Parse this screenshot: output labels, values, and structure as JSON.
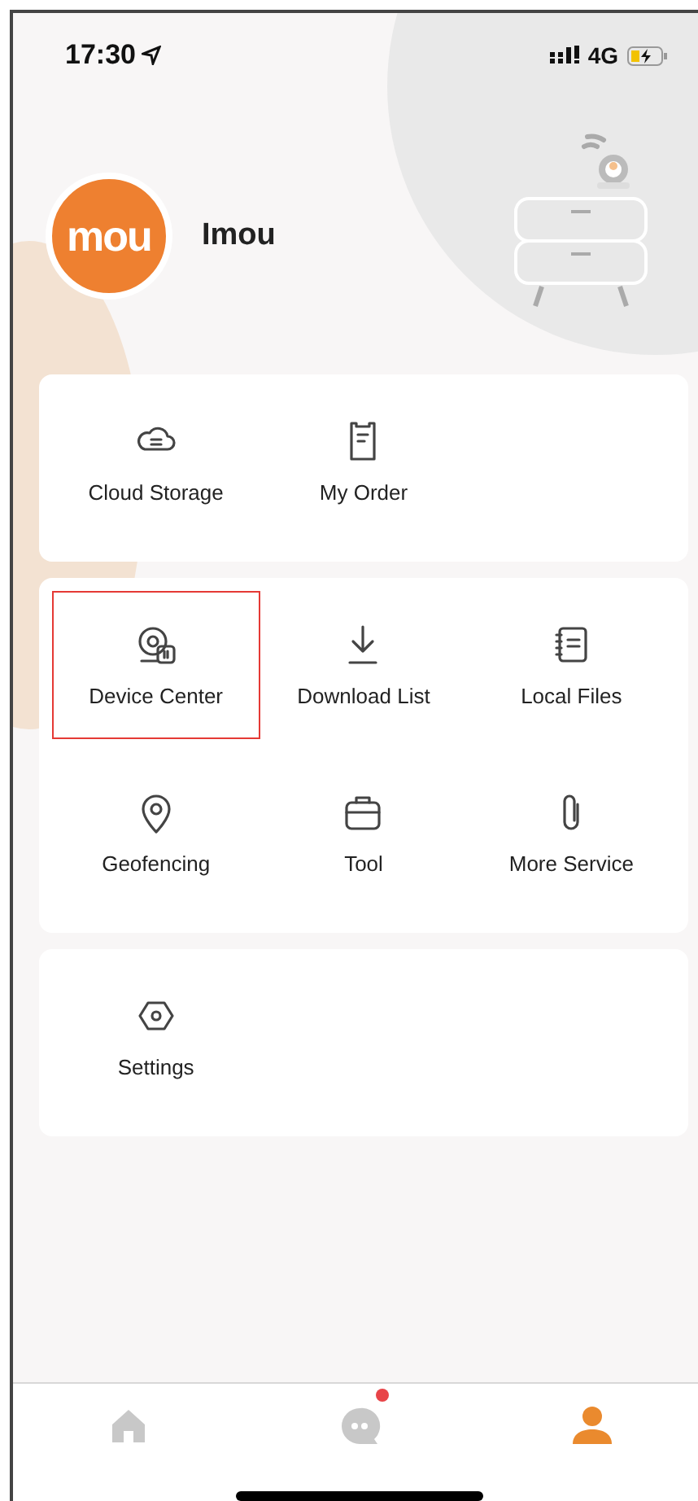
{
  "status_bar": {
    "time": "17:30",
    "network": "4G"
  },
  "profile": {
    "logo_text": "mou",
    "name": "Imou"
  },
  "cards": [
    {
      "items": [
        {
          "kind": "cloud",
          "label": "Cloud Storage",
          "highlighted": false
        },
        {
          "kind": "order",
          "label": "My Order",
          "highlighted": false
        }
      ]
    },
    {
      "items": [
        {
          "kind": "device",
          "label": "Device Center",
          "highlighted": true
        },
        {
          "kind": "download",
          "label": "Download List",
          "highlighted": false
        },
        {
          "kind": "files",
          "label": "Local Files",
          "highlighted": false
        },
        {
          "kind": "pin",
          "label": "Geofencing",
          "highlighted": false
        },
        {
          "kind": "toolbox",
          "label": "Tool",
          "highlighted": false
        },
        {
          "kind": "clip",
          "label": "More Service",
          "highlighted": false
        }
      ]
    },
    {
      "items": [
        {
          "kind": "settings",
          "label": "Settings",
          "highlighted": false
        }
      ]
    }
  ],
  "tab_bar": [
    {
      "kind": "home",
      "selected": false,
      "badge": false
    },
    {
      "kind": "chat",
      "selected": false,
      "badge": true
    },
    {
      "kind": "person",
      "selected": true,
      "badge": false
    }
  ]
}
